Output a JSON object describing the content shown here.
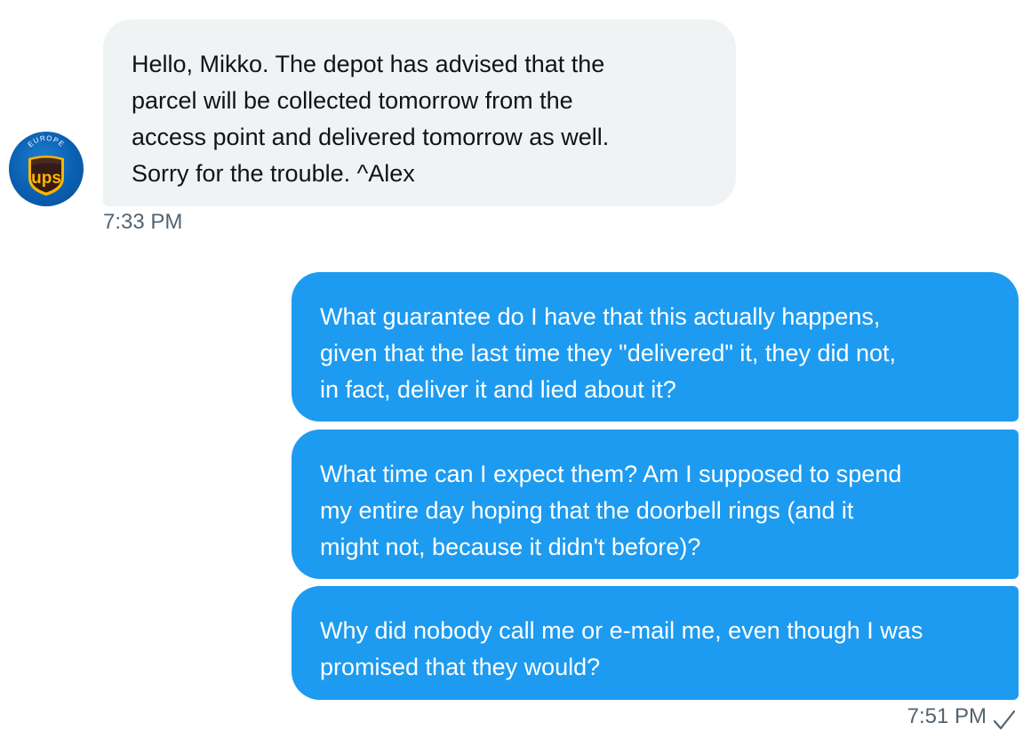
{
  "avatar": {
    "label_top": "EUROPE",
    "logo_text": "ups",
    "colors": {
      "ring": "#0a5fb0",
      "shield": "#351c15",
      "gold": "#ffb500"
    }
  },
  "messages": [
    {
      "direction": "received",
      "lines": [
        "Hello, Mikko. The depot has advised that the",
        "parcel will be collected tomorrow from the",
        "access point and delivered tomorrow as well.",
        "Sorry for the trouble. ^Alex"
      ]
    },
    {
      "direction": "sent",
      "lines": [
        "What guarantee do I have that this actually happens,",
        "given that the last time they \"delivered\" it, they did not,",
        "in fact, deliver it and lied about it?"
      ]
    },
    {
      "direction": "sent",
      "lines": [
        "What time can I expect them? Am I supposed to spend",
        "my entire day hoping that the doorbell rings (and it",
        "might not, because it didn't before)?"
      ]
    },
    {
      "direction": "sent",
      "lines": [
        "Why did nobody call me or e-mail me, even though I was",
        "promised that they would?"
      ]
    }
  ],
  "timestamps": {
    "received": "7:33 PM",
    "sent": "7:51 PM"
  },
  "icons": {
    "read_receipt": "check-icon"
  },
  "colors": {
    "received_bubble": "#eff3f4",
    "sent_bubble": "#1d9bf0",
    "timestamp": "#536471"
  }
}
